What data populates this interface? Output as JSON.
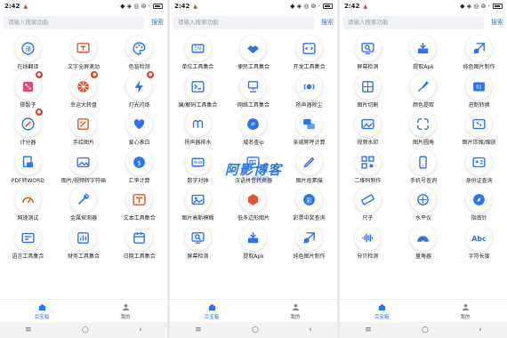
{
  "status_time": "2:42",
  "status_icons": "◆ ◈ ◎ ⊚ ·",
  "search": {
    "placeholder": "请输入搜索功能",
    "button": "搜索"
  },
  "tabbar": [
    {
      "label": "百宝箱",
      "icon": "home-icon",
      "active": true
    },
    {
      "label": "我的",
      "icon": "person-icon",
      "active": false
    }
  ],
  "colors": {
    "accent": "#2b74f0",
    "badge": "#e53b2c"
  },
  "watermark": {
    "title": "阿影博客",
    "sub": "AYBK.CN"
  },
  "screens": [
    {
      "tools": [
        {
          "label": "在线翻译",
          "icon": "translate-icon"
        },
        {
          "label": "文字全屏滚动",
          "icon": "scroll-text-icon"
        },
        {
          "label": "色盲检测",
          "icon": "palette-icon"
        },
        {
          "label": "掷骰子",
          "icon": "dice-icon",
          "badge": "●"
        },
        {
          "label": "幸运大转盘",
          "icon": "wheel-icon",
          "badge": "●"
        },
        {
          "label": "灯光闪烁",
          "icon": "flash-icon",
          "badge": "●"
        },
        {
          "label": "计分器",
          "icon": "counter-icon",
          "badge": "●"
        },
        {
          "label": "手绘图片",
          "icon": "brush-icon"
        },
        {
          "label": "爱心表白",
          "icon": "heart-icon"
        },
        {
          "label": "PDF转WORD",
          "icon": "pdf-icon"
        },
        {
          "label": "图片/视频转字符画",
          "icon": "image-text-icon"
        },
        {
          "label": "汇率计算",
          "icon": "currency-icon"
        },
        {
          "label": "网速测试",
          "icon": "speedometer-icon"
        },
        {
          "label": "金属探测器",
          "icon": "detector-icon"
        },
        {
          "label": "文本工具集合",
          "icon": "text-tools-icon"
        },
        {
          "label": "语言工具集合",
          "icon": "language-icon"
        },
        {
          "label": "财务工具集合",
          "icon": "finance-icon"
        },
        {
          "label": "日期工具集合",
          "icon": "calendar-icon"
        }
      ]
    },
    {
      "tools": [
        {
          "label": "单位工具集合",
          "icon": "unit-icon"
        },
        {
          "label": "便民工具集合",
          "icon": "handshake-icon"
        },
        {
          "label": "开发工具集合",
          "icon": "code-icon"
        },
        {
          "label": "编/解码工具集合",
          "icon": "terminal-icon"
        },
        {
          "label": "网络工具集合",
          "icon": "network-icon"
        },
        {
          "label": "扬声器除尘",
          "icon": "speaker-icon"
        },
        {
          "label": "扬声器排水",
          "icon": "waves-icon"
        },
        {
          "label": "域名查ip",
          "icon": "ip-icon"
        },
        {
          "label": "亲戚称呼计算",
          "icon": "chat-icon"
        },
        {
          "label": "数字对钟",
          "icon": "digital-clock-icon"
        },
        {
          "label": "汉语拼音转换器",
          "icon": "pinyin-icon"
        },
        {
          "label": "图片抠素描",
          "icon": "sketch-icon"
        },
        {
          "label": "图片高斯模糊",
          "icon": "blur-icon"
        },
        {
          "label": "低多边形图片",
          "icon": "polygon-icon"
        },
        {
          "label": "彩票中奖查询",
          "icon": "lottery-icon"
        },
        {
          "label": "屏幕检测",
          "icon": "screen-check-icon"
        },
        {
          "label": "提取Apk",
          "icon": "extract-icon"
        },
        {
          "label": "纯色图片制作",
          "icon": "solid-image-icon"
        }
      ]
    },
    {
      "tools": [
        {
          "label": "屏幕检测",
          "icon": "screen-check-icon"
        },
        {
          "label": "提取Apk",
          "icon": "extract-icon"
        },
        {
          "label": "纯色图片制作",
          "icon": "solid-image-icon"
        },
        {
          "label": "图片切割",
          "icon": "crop-icon"
        },
        {
          "label": "颜色提取",
          "icon": "eyedropper-icon"
        },
        {
          "label": "进制转换",
          "icon": "binary-icon"
        },
        {
          "label": "视频水印",
          "icon": "video-watermark-icon"
        },
        {
          "label": "图片圆角",
          "icon": "rounded-corner-icon"
        },
        {
          "label": "图片压缩/缩放",
          "icon": "compress-icon"
        },
        {
          "label": "二维码制作",
          "icon": "qrcode-icon"
        },
        {
          "label": "手机号查询",
          "icon": "phone-icon"
        },
        {
          "label": "身份证查询",
          "icon": "id-card-icon"
        },
        {
          "label": "尺子",
          "icon": "ruler-icon"
        },
        {
          "label": "水平仪",
          "icon": "level-icon"
        },
        {
          "label": "指南针",
          "icon": "compass-icon"
        },
        {
          "label": "分贝检测",
          "icon": "decibel-icon"
        },
        {
          "label": "量角器",
          "icon": "protractor-icon"
        },
        {
          "label": "字符长度",
          "icon": "text-length-icon"
        }
      ]
    }
  ]
}
